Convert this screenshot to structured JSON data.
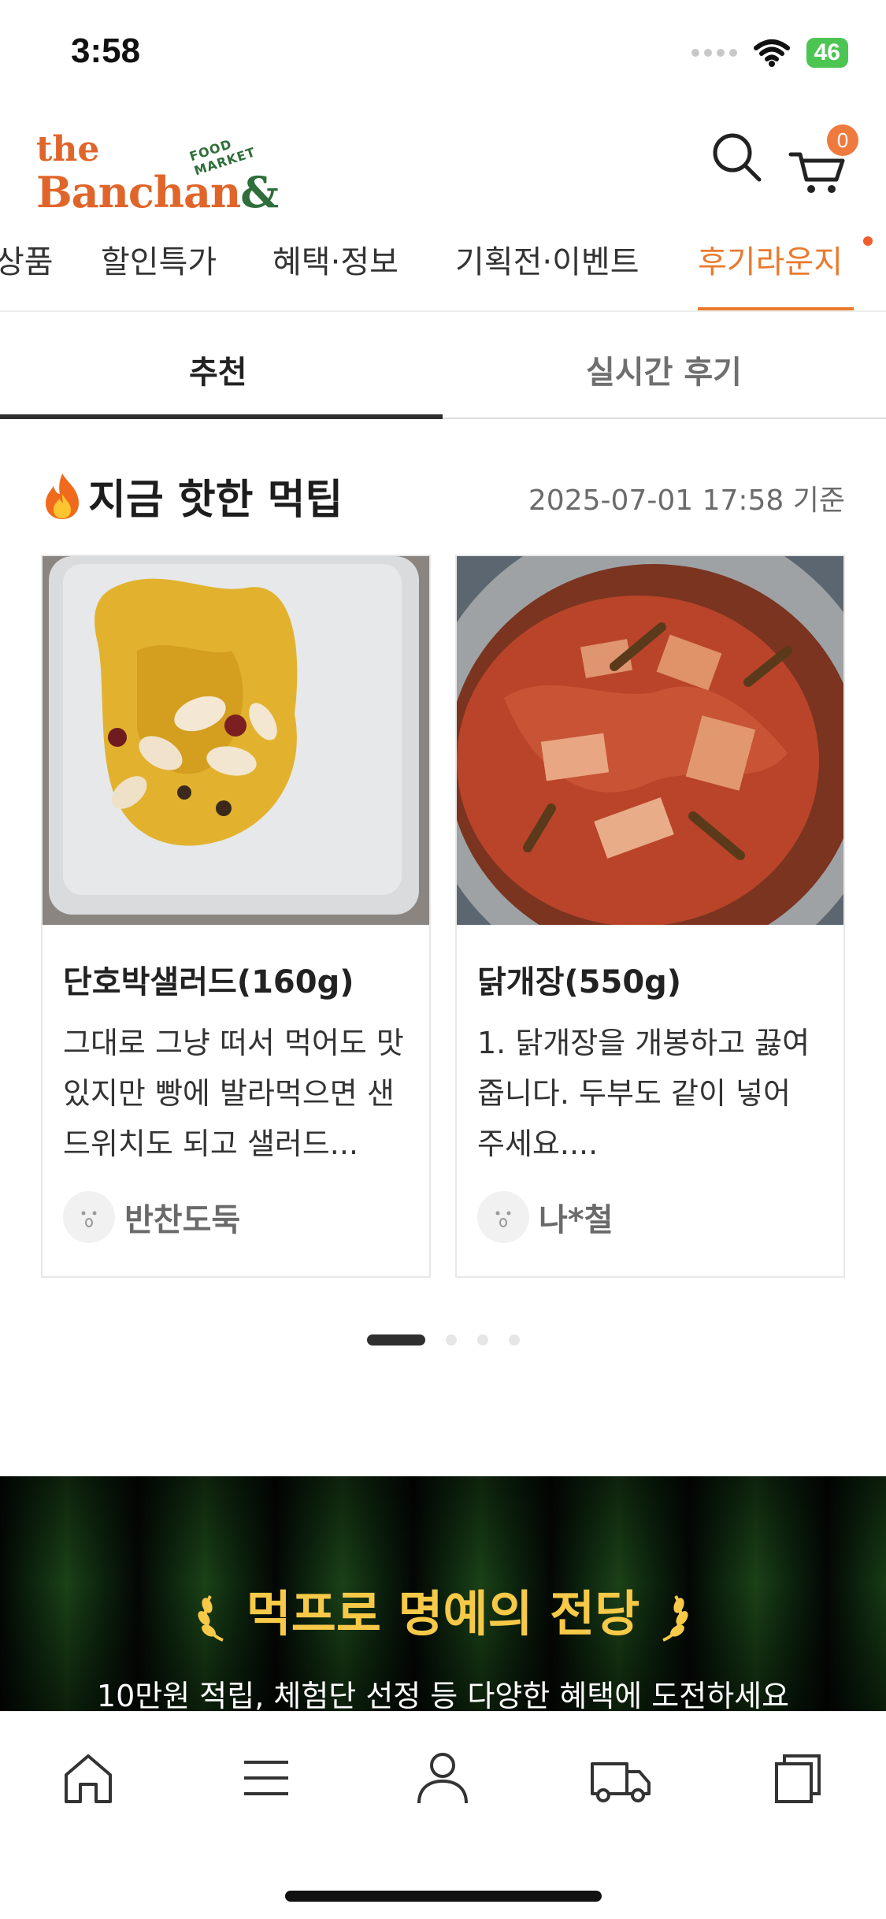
{
  "status": {
    "time": "3:58",
    "battery": "46"
  },
  "header": {
    "logo_the": "the",
    "logo_banchan": "Banchan",
    "logo_amp": "&",
    "logo_tag": "FOOD MARKET",
    "cart_count": "0"
  },
  "categories": [
    "상품",
    "할인특가",
    "혜택·정보",
    "기획전·이벤트",
    "후기라운지"
  ],
  "active_category": "후기라운지",
  "sub_tabs": {
    "active": "추천",
    "inactive": "실시간 후기"
  },
  "section": {
    "title": "지금 핫한 먹팁",
    "timestamp": "2025-07-01 17:58 기준"
  },
  "cards": [
    {
      "title": "단호박샐러드(160g)",
      "body": "그대로 그냥 떠서 먹어도 맛있지만 빵에 발라먹으면 샌드위치도 되고 샐러드...",
      "author": "반찬도둑"
    },
    {
      "title": "닭개장(550g)",
      "body": "1. 닭개장을 개봉하고 끓여 줍니다. 두부도 같이 넣어 주세요....",
      "author": "나*철"
    }
  ],
  "pager": {
    "total": 4,
    "active": 1
  },
  "banner": {
    "title": "먹프로 명예의 전당",
    "subtitle": "10만원 적립, 체험단 선정 등 다양한 혜택에 도전하세요"
  },
  "colors": {
    "accent": "#ea7a2e",
    "banner_title": "#f7c948"
  }
}
